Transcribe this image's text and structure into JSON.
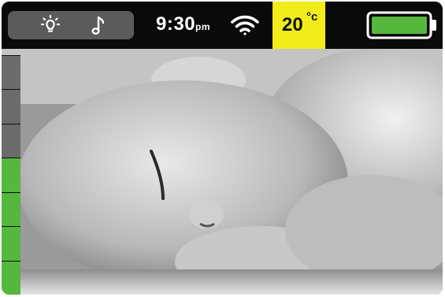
{
  "status_bar": {
    "time": "9:30",
    "ampm": "pm",
    "temperature": "20",
    "temperature_unit": "°c",
    "battery_level": 1.0,
    "icons": [
      "night-light-icon",
      "music-note-icon",
      "wifi-icon",
      "battery-icon"
    ]
  },
  "sound_meter": {
    "segments_total": 7,
    "segments_lit": 4
  },
  "colors": {
    "background": "#0a0a0a",
    "icon_pill": "#5b5b5b",
    "temperature_highlight": "#f2ec1a",
    "battery_fill": "#55b73c",
    "meter_lit": "#55b73c",
    "meter_unlit": "#6c6c6c"
  }
}
